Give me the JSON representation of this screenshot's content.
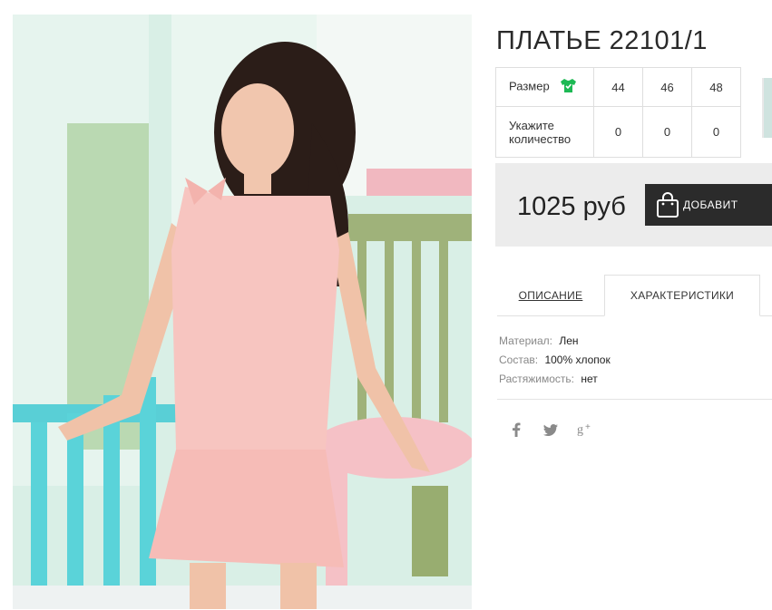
{
  "product": {
    "title": "ПЛАТЬЕ 22101/1",
    "image_alt_icon": "dress-photo"
  },
  "size_table": {
    "size_label": "Размер",
    "size_icon": "tshirt-icon",
    "size_icon_color": "#1db954",
    "sizes": [
      "44",
      "46",
      "48"
    ],
    "quantity_label_line1": "Укажите",
    "quantity_label_line2": "количество",
    "quantities": [
      "0",
      "0",
      "0"
    ]
  },
  "purchase": {
    "price": "1025 руб",
    "button_label": "ДОБАВИТ",
    "button_icon": "shopping-bag-icon",
    "button_color": "#2b2b2b",
    "box_color": "#ececec"
  },
  "tabs": {
    "description": "ОПИСАНИЕ",
    "characteristics": "ХАРАКТЕРИСТИКИ",
    "active": "characteristics"
  },
  "specs": [
    {
      "label": "Материал:",
      "value": "Лен"
    },
    {
      "label": "Состав:",
      "value": "100% хлопок"
    },
    {
      "label": "Растяжимость:",
      "value": "нет"
    }
  ],
  "social": [
    {
      "name": "facebook-icon",
      "glyph": "f"
    },
    {
      "name": "twitter-icon",
      "glyph": "t"
    },
    {
      "name": "google-plus-icon",
      "glyph": "g+"
    }
  ]
}
